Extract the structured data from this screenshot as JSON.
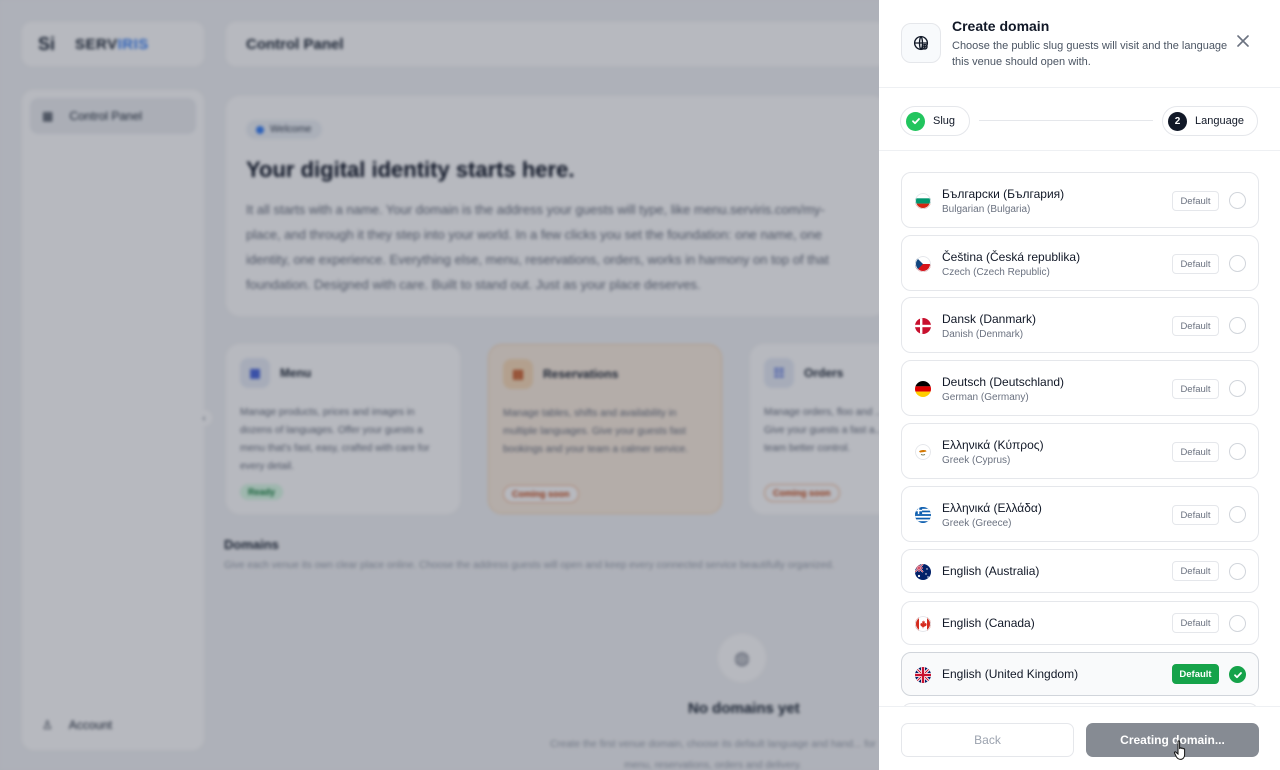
{
  "background": {
    "logo": {
      "mark": "Si",
      "word_a": "SERV",
      "word_b": "IRIS"
    },
    "topbar_title": "Control Panel",
    "sidebar": {
      "item": "Control Panel",
      "account": "Account"
    },
    "hero": {
      "pill": "Welcome",
      "title": "Your digital identity starts here.",
      "body": "It all starts with a name. Your domain is the address your guests will type, like menu.serviris.com/my-place, and through it they step into your world. In a few clicks you set the foundation: one name, one identity, one experience. Everything else, menu, reservations, orders, works in harmony on top of that foundation. Designed with care. Built to stand out. Just as your place deserves."
    },
    "cards": [
      {
        "title": "Menu",
        "text": "Manage products, prices and images in dozens of languages. Offer your guests a menu that's fast, easy, crafted with care for every detail.",
        "tag": "Ready"
      },
      {
        "title": "Reservations",
        "text": "Manage tables, shifts and availability in multiple languages. Give your guests fast bookings and your team a calmer service.",
        "tag": "Coming soon"
      },
      {
        "title": "Orders",
        "text": "Manage orders, floo and ... Give your guests a fast a... team better control.",
        "tag": "Coming soon"
      }
    ],
    "domains": {
      "title": "Domains",
      "subtitle": "Give each venue its own clear place online. Choose the address guests will open and keep every connected service beautifully organized.",
      "empty_title": "No domains yet",
      "empty_sub": "Create the first venue domain, choose its default language and hand... for menu, reservations, orders and delivery."
    }
  },
  "drawer": {
    "title": "Create domain",
    "subtitle": "Choose the public slug guests will visit and the language this venue should open with.",
    "icon": "globe-icon",
    "steps": [
      {
        "label": "Slug",
        "state": "done"
      },
      {
        "label": "Language",
        "number": "2",
        "state": "active"
      }
    ],
    "default_label": "Default",
    "languages": [
      {
        "name": "Български (България)",
        "english": "Bulgarian (Bulgaria)",
        "flag": "bg",
        "selected": false
      },
      {
        "name": "Čeština (Česká republika)",
        "english": "Czech (Czech Republic)",
        "flag": "cz",
        "selected": false
      },
      {
        "name": "Dansk (Danmark)",
        "english": "Danish (Denmark)",
        "flag": "dk",
        "selected": false
      },
      {
        "name": "Deutsch (Deutschland)",
        "english": "German (Germany)",
        "flag": "de",
        "selected": false
      },
      {
        "name": "Ελληνικά (Κύπρος)",
        "english": "Greek (Cyprus)",
        "flag": "cy",
        "selected": false
      },
      {
        "name": "Ελληνικά (Ελλάδα)",
        "english": "Greek (Greece)",
        "flag": "gr",
        "selected": false
      },
      {
        "name": "English (Australia)",
        "english": "",
        "flag": "au",
        "selected": false
      },
      {
        "name": "English (Canada)",
        "english": "",
        "flag": "ca",
        "selected": false
      },
      {
        "name": "English (United Kingdom)",
        "english": "",
        "flag": "gb",
        "selected": true
      }
    ],
    "footer": {
      "back_label": "Back",
      "create_label": "Creating domain..."
    }
  },
  "colors": {
    "accent_green": "#16a34a",
    "check_green": "#22c55e",
    "create_disabled": "#868b93"
  }
}
